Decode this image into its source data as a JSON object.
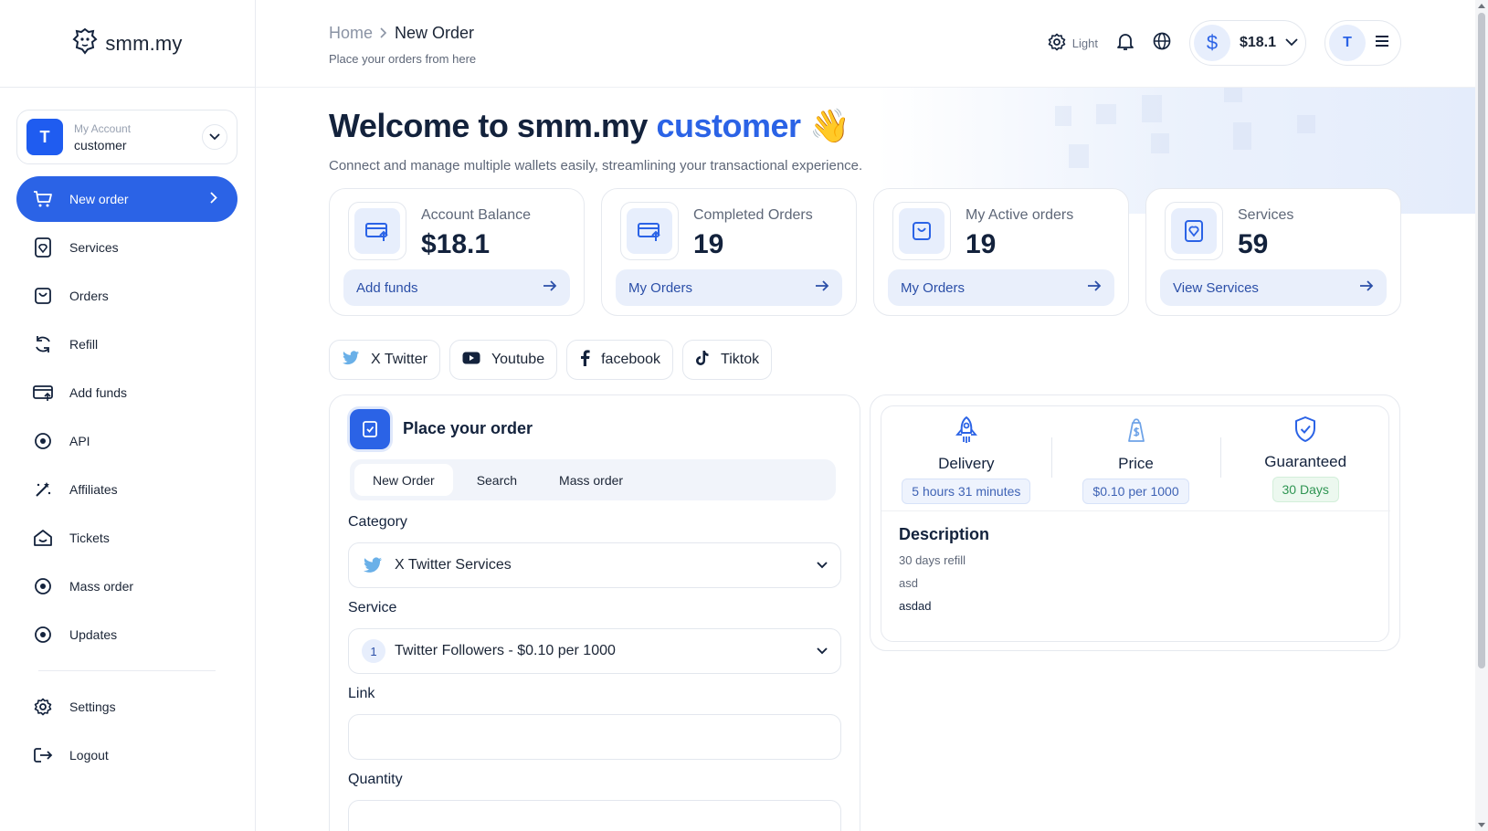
{
  "brand": {
    "name": "smm.my"
  },
  "account": {
    "label": "My Account",
    "name": "customer",
    "initial": "T"
  },
  "sidebar": {
    "items": [
      {
        "label": "New order",
        "icon": "cart-icon"
      },
      {
        "label": "Services",
        "icon": "services-icon"
      },
      {
        "label": "Orders",
        "icon": "orders-bag-icon"
      },
      {
        "label": "Refill",
        "icon": "refill-icon"
      },
      {
        "label": "Add funds",
        "icon": "card-icon"
      },
      {
        "label": "API",
        "icon": "api-icon"
      },
      {
        "label": "Affiliates",
        "icon": "affiliates-icon"
      },
      {
        "label": "Tickets",
        "icon": "tickets-icon"
      },
      {
        "label": "Mass order",
        "icon": "mass-order-icon"
      },
      {
        "label": "Updates",
        "icon": "updates-icon"
      }
    ],
    "bottom": [
      {
        "label": "Settings",
        "icon": "gear-icon"
      },
      {
        "label": "Logout",
        "icon": "logout-icon"
      }
    ]
  },
  "header": {
    "breadcrumb_home": "Home",
    "breadcrumb_current": "New Order",
    "subtitle": "Place your orders from here",
    "theme_label": "Light",
    "balance": "$18.1",
    "user_initial": "T"
  },
  "hero": {
    "title_prefix": "Welcome to smm.my",
    "title_user": "customer",
    "emoji": "👋",
    "subtitle": "Connect and manage multiple wallets easily, streamlining your transactional experience."
  },
  "stats": [
    {
      "label": "Account Balance",
      "value": "$18.1",
      "action": "Add funds"
    },
    {
      "label": "Completed Orders",
      "value": "19",
      "action": "My Orders"
    },
    {
      "label": "My Active orders",
      "value": "19",
      "action": "My Orders"
    },
    {
      "label": "Services",
      "value": "59",
      "action": "View Services"
    }
  ],
  "platforms": [
    {
      "label": "X Twitter",
      "icon": "twitter-icon"
    },
    {
      "label": "Youtube",
      "icon": "youtube-icon"
    },
    {
      "label": "facebook",
      "icon": "facebook-icon"
    },
    {
      "label": "Tiktok",
      "icon": "tiktok-icon"
    }
  ],
  "order": {
    "title": "Place your order",
    "tabs": [
      "New Order",
      "Search",
      "Mass order"
    ],
    "category_label": "Category",
    "category_value": "X Twitter Services",
    "service_label": "Service",
    "service_id": "1",
    "service_value": "Twitter Followers - $0.10 per 1000",
    "link_label": "Link",
    "link_value": "",
    "quantity_label": "Quantity",
    "quantity_value": ""
  },
  "service_info": {
    "delivery_label": "Delivery",
    "delivery_value": "5 hours 31 minutes",
    "price_label": "Price",
    "price_value": "$0.10 per 1000",
    "guarantee_label": "Guaranteed",
    "guarantee_value": "30 Days",
    "description_title": "Description",
    "description_lines": [
      "30 days refill",
      "asd",
      "asdad"
    ]
  },
  "colors": {
    "accent": "#2b63e6",
    "accent_soft": "#e7eefc",
    "text": "#13223c",
    "green": "#2f9553"
  }
}
